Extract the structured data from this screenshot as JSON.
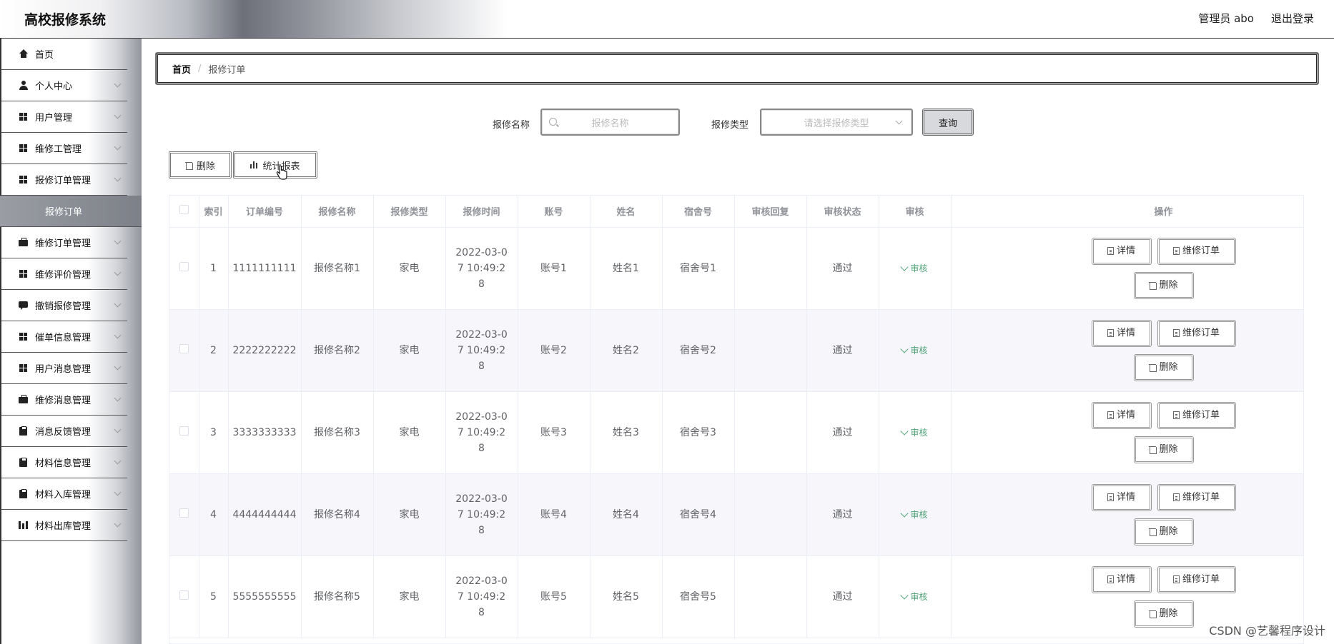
{
  "header": {
    "app_title": "高校报修系统",
    "admin_label": "管理员 abo",
    "logout_label": "退出登录"
  },
  "sidebar": {
    "items": [
      {
        "label": "首页",
        "icon": "home-icon"
      },
      {
        "label": "个人中心",
        "icon": "user-icon"
      },
      {
        "label": "用户管理",
        "icon": "grid-icon"
      },
      {
        "label": "维修工管理",
        "icon": "grid-icon"
      },
      {
        "label": "报修订单管理",
        "icon": "grid-icon"
      },
      {
        "label": "维修订单管理",
        "icon": "briefcase-icon"
      },
      {
        "label": "维修评价管理",
        "icon": "grid-icon"
      },
      {
        "label": "撤销报修管理",
        "icon": "chat-icon"
      },
      {
        "label": "催单信息管理",
        "icon": "grid-icon"
      },
      {
        "label": "用户消息管理",
        "icon": "grid-icon"
      },
      {
        "label": "维修消息管理",
        "icon": "briefcase-icon"
      },
      {
        "label": "消息反馈管理",
        "icon": "clipboard-icon"
      },
      {
        "label": "材料信息管理",
        "icon": "clipboard-icon"
      },
      {
        "label": "材料入库管理",
        "icon": "clipboard-icon"
      },
      {
        "label": "材料出库管理",
        "icon": "bars-icon"
      }
    ],
    "active_sub": "报修订单"
  },
  "breadcrumb": {
    "home": "首页",
    "separator": "/",
    "current": "报修订单"
  },
  "search": {
    "name_label": "报修名称",
    "name_placeholder": "报修名称",
    "type_label": "报修类型",
    "type_placeholder": "请选择报修类型",
    "query_label": "查询"
  },
  "toolbar": {
    "delete_label": "删除",
    "report_label": "统计报表"
  },
  "table": {
    "headers": [
      "",
      "索引",
      "订单编号",
      "报修名称",
      "报修类型",
      "报修时间",
      "账号",
      "姓名",
      "宿舍号",
      "审核回复",
      "审核状态",
      "审核",
      "操作"
    ],
    "rows": [
      {
        "index": "1",
        "order_no": "1111111111",
        "name": "报修名称1",
        "type": "家电",
        "time": "2022-03-07 10:49:28",
        "account": "账号1",
        "person": "姓名1",
        "dorm": "宿舍号1",
        "reply": "",
        "status": "通过"
      },
      {
        "index": "2",
        "order_no": "2222222222",
        "name": "报修名称2",
        "type": "家电",
        "time": "2022-03-07 10:49:28",
        "account": "账号2",
        "person": "姓名2",
        "dorm": "宿舍号2",
        "reply": "",
        "status": "通过"
      },
      {
        "index": "3",
        "order_no": "3333333333",
        "name": "报修名称3",
        "type": "家电",
        "time": "2022-03-07 10:49:28",
        "account": "账号3",
        "person": "姓名3",
        "dorm": "宿舍号3",
        "reply": "",
        "status": "通过"
      },
      {
        "index": "4",
        "order_no": "4444444444",
        "name": "报修名称4",
        "type": "家电",
        "time": "2022-03-07 10:49:28",
        "account": "账号4",
        "person": "姓名4",
        "dorm": "宿舍号4",
        "reply": "",
        "status": "通过"
      },
      {
        "index": "5",
        "order_no": "5555555555",
        "name": "报修名称5",
        "type": "家电",
        "time": "2022-03-07 10:49:28",
        "account": "账号5",
        "person": "姓名5",
        "dorm": "宿舍号5",
        "reply": "",
        "status": "通过"
      }
    ],
    "audit_label": "审核",
    "detail_label": "详情",
    "repair_order_label": "维修订单",
    "delete_label": "删除"
  },
  "watermark": "CSDN @艺馨程序设计",
  "colors": {
    "audit_green": "#4fa377",
    "stripe": "#f7f7fb"
  }
}
